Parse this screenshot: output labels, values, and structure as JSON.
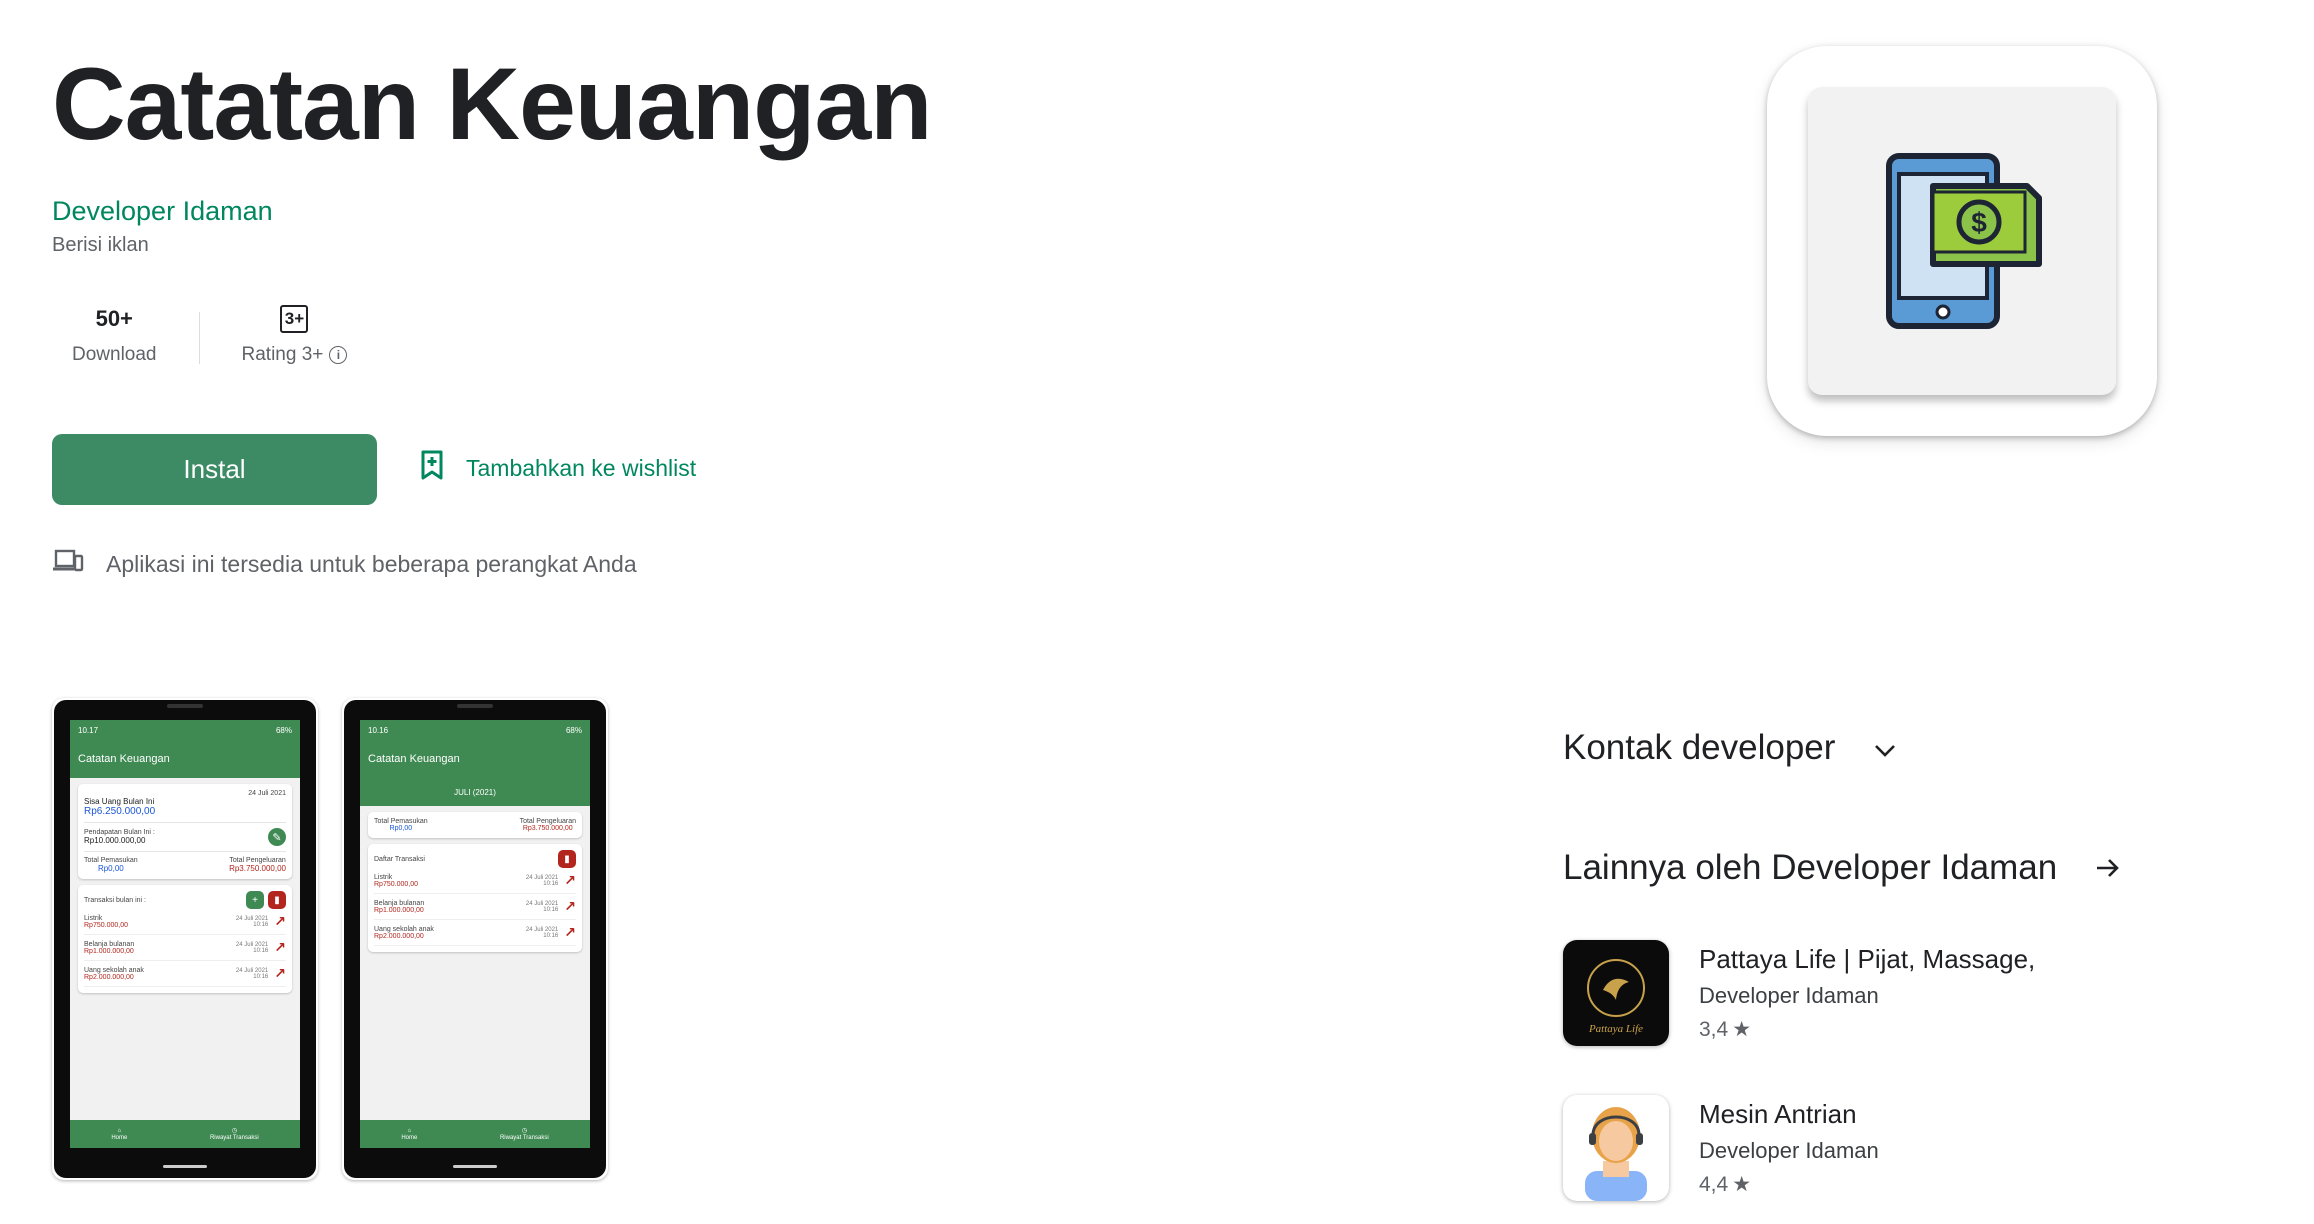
{
  "app": {
    "title": "Catatan Keuangan",
    "developer": "Developer Idaman",
    "ads_note": "Berisi iklan"
  },
  "stats": {
    "downloads_value": "50+",
    "downloads_label": "Download",
    "rating_badge": "3+",
    "rating_label": "Rating 3+"
  },
  "actions": {
    "install_label": "Instal",
    "wishlist_label": "Tambahkan ke wishlist"
  },
  "availability_text": "Aplikasi ini tersedia untuk beberapa perangkat Anda",
  "icons": {
    "device": "devices-icon",
    "wishlist": "bookmark-add-icon",
    "info": "info-icon",
    "app": "phone-money-icon"
  },
  "screenshot1": {
    "time": "10.17",
    "battery": "68%",
    "appbar": "Catatan Keuangan",
    "date": "24 Juli 2021",
    "sisa_label": "Sisa Uang Bulan Ini",
    "sisa_value": "Rp6.250.000,00",
    "pendapatan_label": "Pendapatan Bulan Ini :",
    "pendapatan_value": "Rp10.000.000,00",
    "pemasukan_label": "Total Pemasukan",
    "pemasukan_value": "Rp0,00",
    "pengeluaran_label": "Total Pengeluaran",
    "pengeluaran_value": "Rp3.750.000,00",
    "transaksi_label": "Transaksi bulan ini :",
    "transactions": [
      {
        "name": "Listrik",
        "amount": "Rp750.000,00",
        "date": "24 Juli 2021",
        "time": "10:16"
      },
      {
        "name": "Belanja bulanan",
        "amount": "Rp1.000.000,00",
        "date": "24 Juli 2021",
        "time": "10:16"
      },
      {
        "name": "Uang sekolah anak",
        "amount": "Rp2.000.000,00",
        "date": "24 Juli 2021",
        "time": "10:16"
      }
    ],
    "nav_home": "Home",
    "nav_riwayat": "Riwayat Transaksi"
  },
  "screenshot2": {
    "time": "10.16",
    "battery": "68%",
    "appbar": "Catatan Keuangan",
    "month": "JULI (2021)",
    "pemasukan_label": "Total Pemasukan",
    "pemasukan_value": "Rp0,00",
    "pengeluaran_label": "Total Pengeluaran",
    "pengeluaran_value": "Rp3.750.000,00",
    "daftar_label": "Daftar Transaksi",
    "transactions": [
      {
        "name": "Listrik",
        "amount": "Rp750.000,00",
        "date": "24 Juli 2021",
        "time": "10:16"
      },
      {
        "name": "Belanja bulanan",
        "amount": "Rp1.000.000,00",
        "date": "24 Juli 2021",
        "time": "10:16"
      },
      {
        "name": "Uang sekolah anak",
        "amount": "Rp2.000.000,00",
        "date": "24 Juli 2021",
        "time": "10:16"
      }
    ],
    "nav_home": "Home",
    "nav_riwayat": "Riwayat Transaksi"
  },
  "sidebar": {
    "kontak_label": "Kontak developer",
    "lainnya_label": "Lainnya oleh Developer Idaman",
    "related": [
      {
        "title": "Pattaya Life | Pijat, Massage,",
        "developer": "Developer Idaman",
        "rating": "3,4",
        "icon": "pattaya-life-icon",
        "logo_text": "Pattaya Life"
      },
      {
        "title": "Mesin Antrian",
        "developer": "Developer Idaman",
        "rating": "4,4",
        "icon": "mesin-antrian-icon"
      }
    ]
  },
  "colors": {
    "accent": "#01875f",
    "install_bg": "#3d8b65",
    "app_green": "#3f8a53",
    "money_green": "#8bc34a",
    "phone_blue": "#5b9bd5"
  }
}
